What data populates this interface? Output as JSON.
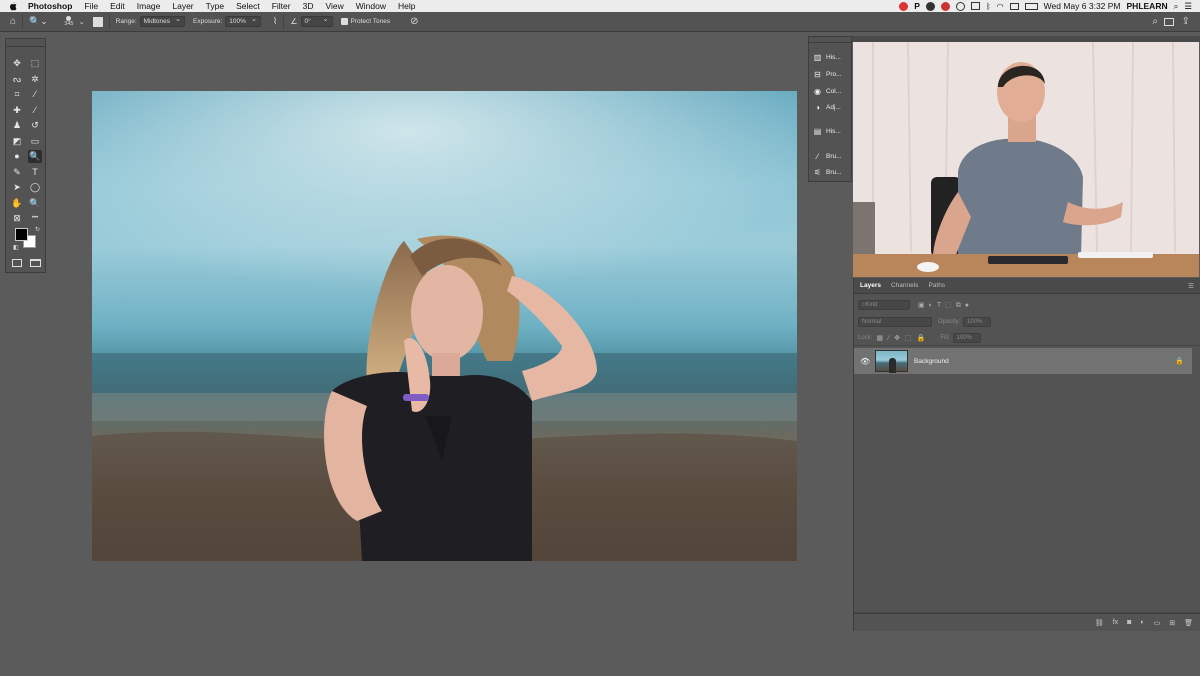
{
  "menubar": {
    "app": "Photoshop",
    "items": [
      "File",
      "Edit",
      "Image",
      "Layer",
      "Type",
      "Select",
      "Filter",
      "3D",
      "View",
      "Window",
      "Help"
    ],
    "datetime": "Wed May 6  3:32 PM",
    "user": "PHLEARN"
  },
  "options": {
    "brush_size": "345",
    "range_label": "Range:",
    "range_value": "Midtones",
    "exposure_label": "Exposure:",
    "exposure_value": "100%",
    "angle_value": "0°",
    "protect_tones": "Protect Tones"
  },
  "tools": [
    {
      "name": "move-tool",
      "glyph": "✥"
    },
    {
      "name": "marquee-tool",
      "glyph": "⬚"
    },
    {
      "name": "lasso-tool",
      "glyph": "ᔓ"
    },
    {
      "name": "magic-wand-tool",
      "glyph": "✲"
    },
    {
      "name": "crop-tool",
      "glyph": "⌗"
    },
    {
      "name": "eyedropper-tool",
      "glyph": "∕"
    },
    {
      "name": "healing-tool",
      "glyph": "✚"
    },
    {
      "name": "brush-tool",
      "glyph": "∕"
    },
    {
      "name": "clone-stamp-tool",
      "glyph": "♟"
    },
    {
      "name": "history-brush-tool",
      "glyph": "↺"
    },
    {
      "name": "eraser-tool",
      "glyph": "◩"
    },
    {
      "name": "gradient-tool",
      "glyph": "▭"
    },
    {
      "name": "blur-tool",
      "glyph": "●"
    },
    {
      "name": "dodge-tool",
      "glyph": "🔍"
    },
    {
      "name": "pen-tool",
      "glyph": "✎"
    },
    {
      "name": "type-tool",
      "glyph": "T"
    },
    {
      "name": "path-selection-tool",
      "glyph": "➤"
    },
    {
      "name": "ellipse-tool",
      "glyph": "◯"
    },
    {
      "name": "hand-tool",
      "glyph": "✋"
    },
    {
      "name": "zoom-tool",
      "glyph": "🔍"
    },
    {
      "name": "frame-tool",
      "glyph": "⊠"
    },
    {
      "name": "more-tools",
      "glyph": "•••"
    }
  ],
  "panel_strip": [
    {
      "name": "histogram",
      "label": "His..."
    },
    {
      "name": "properties",
      "label": "Pro..."
    },
    {
      "name": "color",
      "label": "Col..."
    },
    {
      "name": "adjustments",
      "label": "Adj..."
    },
    {
      "name": "history",
      "label": "His..."
    },
    {
      "name": "brush-settings",
      "label": "Bru..."
    },
    {
      "name": "brushes",
      "label": "Bru..."
    }
  ],
  "layers_panel": {
    "tabs": [
      "Layers",
      "Channels",
      "Paths"
    ],
    "search_placeholder": "Kind",
    "blend_mode": "Normal",
    "opacity_label": "Opacity:",
    "opacity_value": "100%",
    "lock_label": "Lock:",
    "fill_label": "Fill:",
    "fill_value": "100%",
    "layer_name": "Background"
  }
}
